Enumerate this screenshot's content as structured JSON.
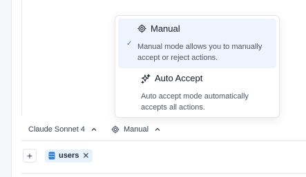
{
  "mode_menu": {
    "options": [
      {
        "label": "Manual",
        "description": "Manual mode allows you to manually accept or reject actions.",
        "selected": true,
        "icon": "target-icon"
      },
      {
        "label": "Auto Accept",
        "description": "Auto accept mode automatically accepts all actions.",
        "selected": false,
        "icon": "sparkle-icon"
      }
    ]
  },
  "toolbar": {
    "model_label": "Claude Sonnet 4",
    "mode_label": "Manual"
  },
  "context": {
    "add_label": "+",
    "chips": [
      {
        "label": "users",
        "icon": "database-icon"
      }
    ]
  },
  "colors": {
    "selected_bg": "#eef4fd",
    "chip_bg": "#e8f2fb",
    "accent": "#4b6fbf"
  }
}
